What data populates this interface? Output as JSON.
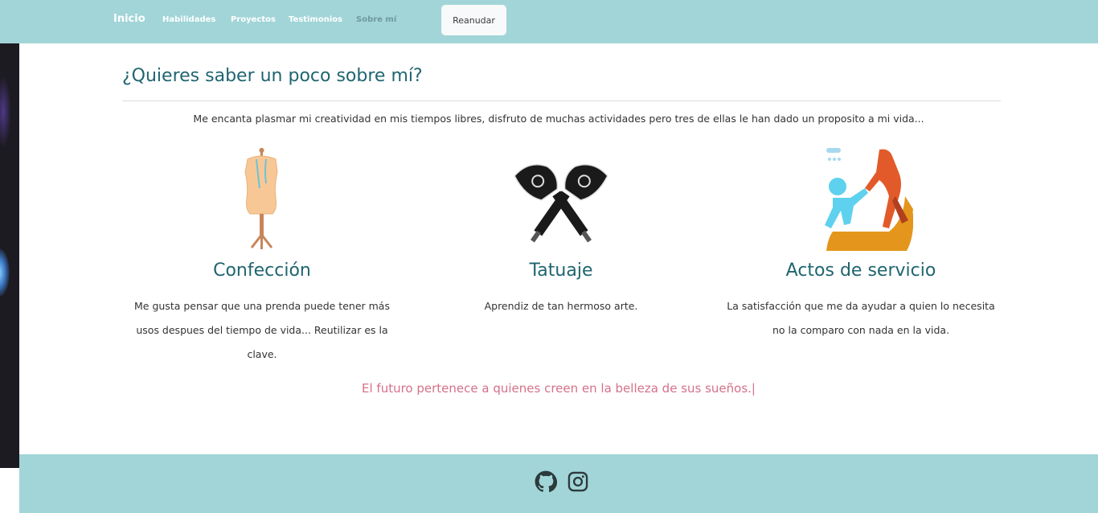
{
  "nav": {
    "brand": "Inicio",
    "links": [
      "Habilidades",
      "Proyectos",
      "Testimonios",
      "Sobre mí"
    ],
    "resume_button": "Reanudar"
  },
  "about": {
    "title": "¿Quieres saber un poco sobre mí?",
    "intro": "Me encanta plasmar mi creatividad en mis tiempos libres, disfruto de muchas actividades pero tres de ellas le han dado un proposito a mi vida...",
    "activities": [
      {
        "icon": "mannequin-icon",
        "title": "Confección",
        "text": "Me gusta pensar que una prenda puede tener más usos despues del tiempo de vida... Reutilizar es la clave."
      },
      {
        "icon": "tattoo-machines-icon",
        "title": "Tatuaje",
        "text": "Aprendiz de tan hermoso arte."
      },
      {
        "icon": "helping-hand-icon",
        "title": "Actos de servicio",
        "text": "La satisfacción que me da ayudar a quien lo necesita no la comparo con nada en la vida."
      }
    ],
    "quote": "El futuro pertenece a quienes creen en la belleza de sus sueños.",
    "quote_cursor": "|"
  },
  "footer": {
    "social": [
      "github-icon",
      "instagram-icon"
    ]
  },
  "colors": {
    "navbar": "#a2d5d8",
    "heading": "#1f6570",
    "quote": "#d5718a",
    "active_link": "#6f9a9d"
  }
}
